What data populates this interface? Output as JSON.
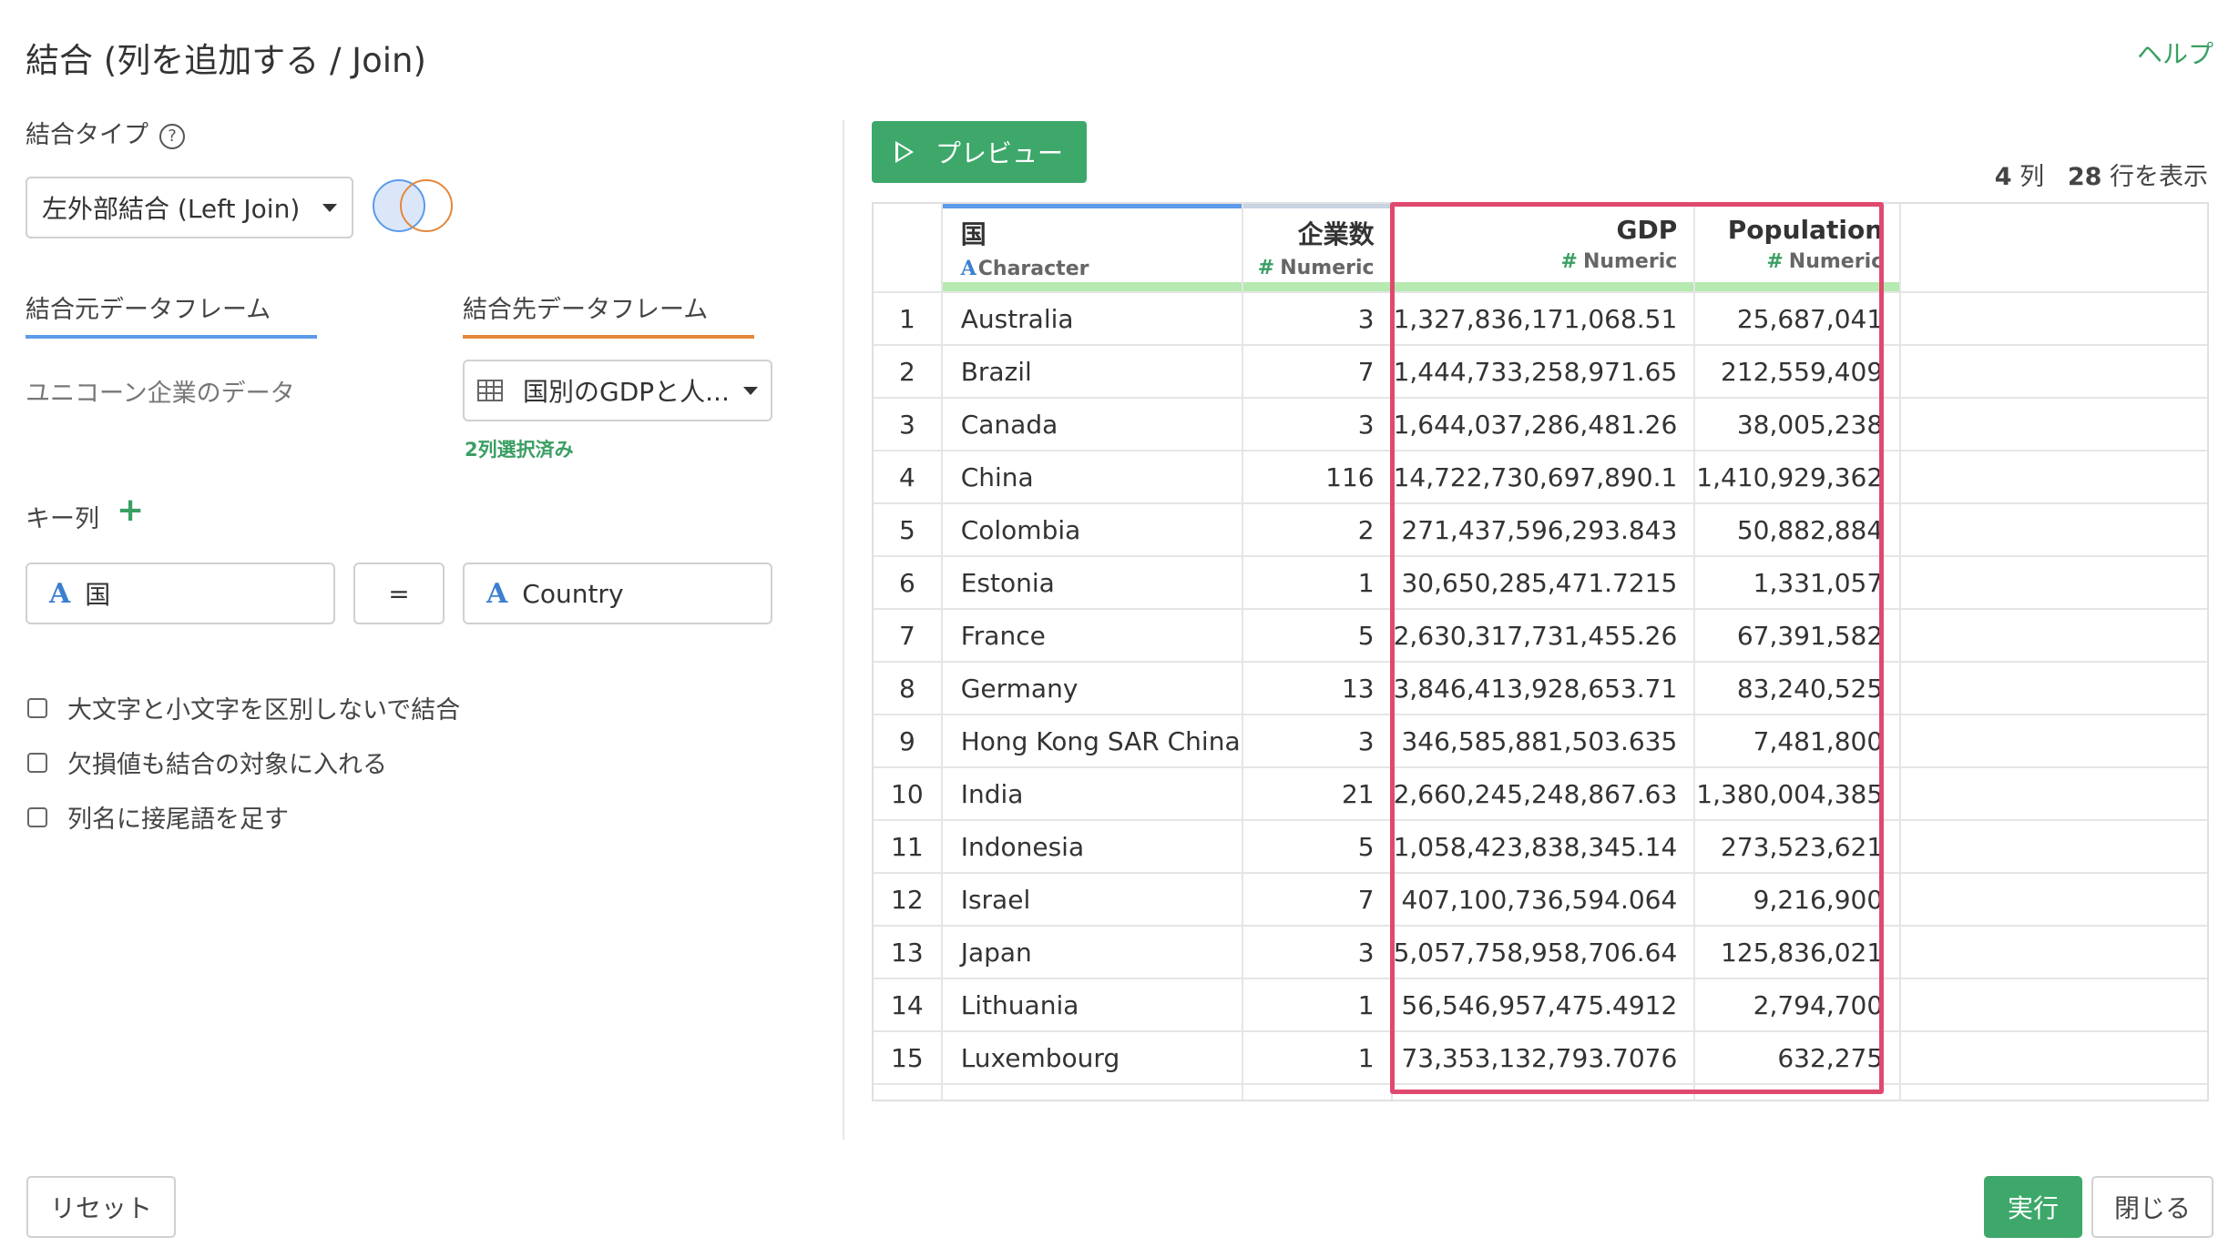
{
  "title": "結合 (列を追加する / Join)",
  "help_label": "ヘルプ",
  "join_type": {
    "label": "結合タイプ",
    "help_icon": "?",
    "selected": "左外部結合 (Left Join)",
    "venn_colors": {
      "left": "#5b9bea",
      "right": "#e4873b"
    }
  },
  "source": {
    "label": "結合元データフレーム",
    "value": "ユニコーン企業のデータ",
    "accent": "#5b9bea"
  },
  "target": {
    "label": "結合先データフレーム",
    "selected": "国別のGDPと人...",
    "selected_count": "2列選択済み",
    "accent": "#e4873b"
  },
  "key": {
    "label": "キー列",
    "add_icon": "+",
    "left_column": "国",
    "equals": "=",
    "right_column": "Country",
    "type_icon": "A"
  },
  "options": [
    {
      "label": "大文字と小文字を区別しないで結合",
      "checked": false
    },
    {
      "label": "欠損値も結合の対象に入れる",
      "checked": false
    },
    {
      "label": "列名に接尾語を足す",
      "checked": false
    }
  ],
  "preview_button": "プレビュー",
  "summary": {
    "cols": "4",
    "cols_unit": "列",
    "rows": "28",
    "rows_unit": "行を表示"
  },
  "table": {
    "columns": [
      {
        "name": "国",
        "type": "Character",
        "type_icon": "A",
        "bar": "#5b9bea"
      },
      {
        "name": "企業数",
        "type": "Numeric",
        "type_icon": "#",
        "bar": "#c8d3e0"
      },
      {
        "name": "GDP",
        "type": "Numeric",
        "type_icon": "#",
        "bar": "#ffffff"
      },
      {
        "name": "Population",
        "type": "Numeric",
        "type_icon": "#",
        "bar": "#ffffff"
      }
    ],
    "rows": [
      [
        "1",
        "Australia",
        "3",
        "1,327,836,171,068.51",
        "25,687,041"
      ],
      [
        "2",
        "Brazil",
        "7",
        "1,444,733,258,971.65",
        "212,559,409"
      ],
      [
        "3",
        "Canada",
        "3",
        "1,644,037,286,481.26",
        "38,005,238"
      ],
      [
        "4",
        "China",
        "116",
        "14,722,730,697,890.1",
        "1,410,929,362"
      ],
      [
        "5",
        "Colombia",
        "2",
        "271,437,596,293.843",
        "50,882,884"
      ],
      [
        "6",
        "Estonia",
        "1",
        "30,650,285,471.7215",
        "1,331,057"
      ],
      [
        "7",
        "France",
        "5",
        "2,630,317,731,455.26",
        "67,391,582"
      ],
      [
        "8",
        "Germany",
        "13",
        "3,846,413,928,653.71",
        "83,240,525"
      ],
      [
        "9",
        "Hong Kong SAR China",
        "3",
        "346,585,881,503.635",
        "7,481,800"
      ],
      [
        "10",
        "India",
        "21",
        "2,660,245,248,867.63",
        "1,380,004,385"
      ],
      [
        "11",
        "Indonesia",
        "5",
        "1,058,423,838,345.14",
        "273,523,621"
      ],
      [
        "12",
        "Israel",
        "7",
        "407,100,736,594.064",
        "9,216,900"
      ],
      [
        "13",
        "Japan",
        "3",
        "5,057,758,958,706.64",
        "125,836,021"
      ],
      [
        "14",
        "Lithuania",
        "1",
        "56,546,957,475.4912",
        "2,794,700"
      ],
      [
        "15",
        "Luxembourg",
        "1",
        "73,353,132,793.7076",
        "632,275"
      ]
    ],
    "highlight_color": "#e0496f"
  },
  "footer": {
    "reset": "リセット",
    "run": "実行",
    "close": "閉じる"
  }
}
